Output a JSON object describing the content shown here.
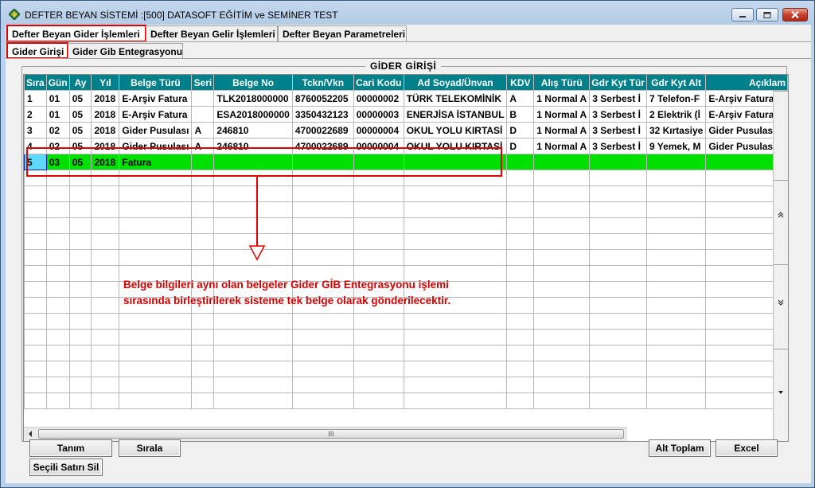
{
  "window": {
    "title": "DEFTER BEYAN SİSTEMİ  :[500]  DATASOFT EĞİTİM ve SEMİNER TEST"
  },
  "tabs": [
    {
      "label": "Defter Beyan Gider İşlemleri"
    },
    {
      "label": "Defter Beyan Gelir İşlemleri"
    },
    {
      "label": "Defter Beyan Parametreleri"
    }
  ],
  "subtabs": [
    {
      "label": "Gider Girişi"
    },
    {
      "label": "Gider Gib Entegrasyonu"
    }
  ],
  "group_title": "GİDER GİRİŞİ",
  "grid": {
    "columns": [
      "Sıra",
      "Gün",
      "Ay",
      "Yıl",
      "Belge Türü",
      "Seri",
      "Belge No",
      "Tckn/Vkn",
      "Cari Kodu",
      "Ad Soyad/Ünvan",
      "KDV",
      "Alış Türü",
      "Gdr Kyt Tür",
      "Gdr Kyt Alt",
      "Açıklam"
    ],
    "rows": [
      [
        "1",
        "01",
        "05",
        "2018",
        "E-Arşiv Fatura",
        "",
        "TLK2018000000",
        "8760052205",
        "00000002",
        "TÜRK TELEKOMİNİK",
        "A",
        "1  Normal A",
        "3  Serbest İ",
        "7 Telefon-F",
        "E-Arşiv Fatura T"
      ],
      [
        "2",
        "01",
        "05",
        "2018",
        "E-Arşiv Fatura",
        "",
        "ESA2018000000",
        "3350432123",
        "00000003",
        "ENERJİSA İSTANBUL",
        "B",
        "1  Normal A",
        "3  Serbest İ",
        "2 Elektrik (İ",
        "E-Arşiv Fatura E"
      ],
      [
        "3",
        "02",
        "05",
        "2018",
        "Gider Pusulası",
        "A",
        "246810",
        "4700022689",
        "00000004",
        "OKUL YOLU KIRTASİ",
        "D",
        "1  Normal A",
        "3  Serbest İ",
        "32 Kırtasiye",
        "Gider Pusulası A"
      ],
      [
        "4",
        "02",
        "05",
        "2018",
        "Gider Pusulası",
        "A",
        "246810",
        "4700022689",
        "00000004",
        "OKUL YOLU KIRTASİ",
        "D",
        "1  Normal A",
        "3  Serbest İ",
        "9 Yemek, M",
        "Gider Pusulası A"
      ],
      [
        "5",
        "03",
        "05",
        "2018",
        "Fatura",
        "",
        "",
        "",
        "",
        "",
        "",
        "",
        "",
        "",
        ""
      ]
    ],
    "highlight_color": "#00e000",
    "header_color": "#00808a",
    "scroll_thumb_glyph": "III"
  },
  "annotation": {
    "line1": "Belge bilgileri aynı olan belgeler Gider GİB Entegrasyonu işlemi",
    "line2": "sırasında birleştirilerek sisteme tek belge olarak gönderilecektir.",
    "color": "#d40000"
  },
  "buttons": {
    "tanim": "Tanım",
    "sirala": "Sırala",
    "secili_sil": "Seçili Satırı Sil",
    "alt_toplam": "Alt Toplam",
    "excel": "Excel"
  }
}
